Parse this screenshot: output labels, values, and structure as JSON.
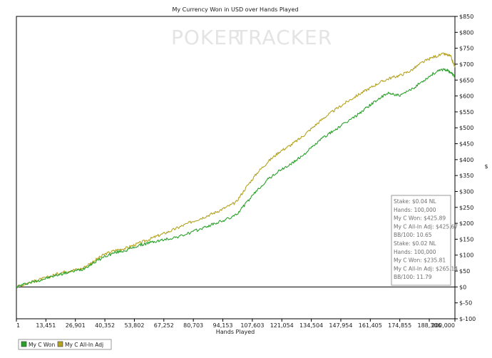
{
  "chart_data": {
    "type": "line",
    "title": "My Currency Won in USD over Hands Played",
    "watermark_left": "POKER",
    "watermark_right": "TRACKER",
    "xlabel": "Hands Played",
    "ylabel": "$",
    "xlim": [
      1,
      200000
    ],
    "ylim": [
      -100,
      850
    ],
    "x_ticks": [
      1,
      13451,
      26901,
      40352,
      53802,
      67252,
      80703,
      94153,
      107603,
      121054,
      134504,
      147954,
      161405,
      174855,
      188306,
      200000
    ],
    "x_tick_labels": [
      "1",
      "13,451",
      "26,901",
      "40,352",
      "53,802",
      "67,252",
      "80,703",
      "94,153",
      "107,603",
      "121,054",
      "134,504",
      "147,954",
      "161,405",
      "174,855",
      "188,306",
      "200,000"
    ],
    "y_ticks": [
      -100,
      -50,
      0,
      50,
      100,
      150,
      200,
      250,
      300,
      350,
      400,
      450,
      500,
      550,
      600,
      650,
      700,
      750,
      800,
      850
    ],
    "y_tick_labels": [
      "$-100",
      "$-50",
      "$0",
      "$50",
      "$100",
      "$150",
      "$200",
      "$250",
      "$300",
      "$350",
      "$400",
      "$450",
      "$500",
      "$550",
      "$600",
      "$650",
      "$700",
      "$750",
      "$800",
      "$850"
    ],
    "grid": false,
    "legend_position": "bottom-left",
    "series": [
      {
        "name": "My C Won",
        "color": "#2aa12a",
        "x": [
          1,
          5000,
          10000,
          15000,
          20000,
          25000,
          30000,
          35000,
          40000,
          45000,
          50000,
          55000,
          60000,
          65000,
          70000,
          75000,
          80000,
          85000,
          90000,
          95000,
          100000,
          105000,
          110000,
          115000,
          120000,
          125000,
          130000,
          135000,
          140000,
          145000,
          150000,
          155000,
          160000,
          165000,
          170000,
          175000,
          180000,
          185000,
          190000,
          195000,
          198000,
          200000
        ],
        "y": [
          0,
          12,
          20,
          30,
          40,
          48,
          55,
          75,
          95,
          108,
          115,
          128,
          138,
          145,
          152,
          160,
          172,
          185,
          198,
          210,
          225,
          265,
          305,
          340,
          365,
          385,
          410,
          440,
          470,
          492,
          515,
          538,
          565,
          590,
          610,
          600,
          620,
          645,
          670,
          685,
          675,
          660
        ]
      },
      {
        "name": "My C All-In Adj",
        "color": "#b5a321",
        "x": [
          1,
          5000,
          10000,
          15000,
          20000,
          25000,
          30000,
          35000,
          40000,
          45000,
          50000,
          55000,
          60000,
          65000,
          70000,
          75000,
          80000,
          85000,
          90000,
          95000,
          100000,
          105000,
          110000,
          115000,
          120000,
          125000,
          130000,
          135000,
          140000,
          145000,
          150000,
          155000,
          160000,
          165000,
          170000,
          175000,
          180000,
          185000,
          190000,
          195000,
          198000,
          200000
        ],
        "y": [
          0,
          12,
          22,
          32,
          45,
          52,
          58,
          80,
          102,
          115,
          122,
          135,
          148,
          162,
          175,
          190,
          205,
          218,
          232,
          248,
          265,
          315,
          360,
          395,
          425,
          445,
          470,
          500,
          530,
          555,
          578,
          600,
          620,
          640,
          655,
          665,
          680,
          705,
          722,
          732,
          725,
          690
        ]
      }
    ],
    "info_box": [
      "Stake: $0.04 NL",
      "Hands: 100,000",
      "My C Won: $425.89",
      "My C All-In Adj: $425.67",
      "BB/100: 10.65",
      "Stake: $0.02 NL",
      "Hands: 100,000",
      "My C Won: $235.81",
      "My C All-In Adj: $265.14",
      "BB/100: 11.79"
    ]
  }
}
